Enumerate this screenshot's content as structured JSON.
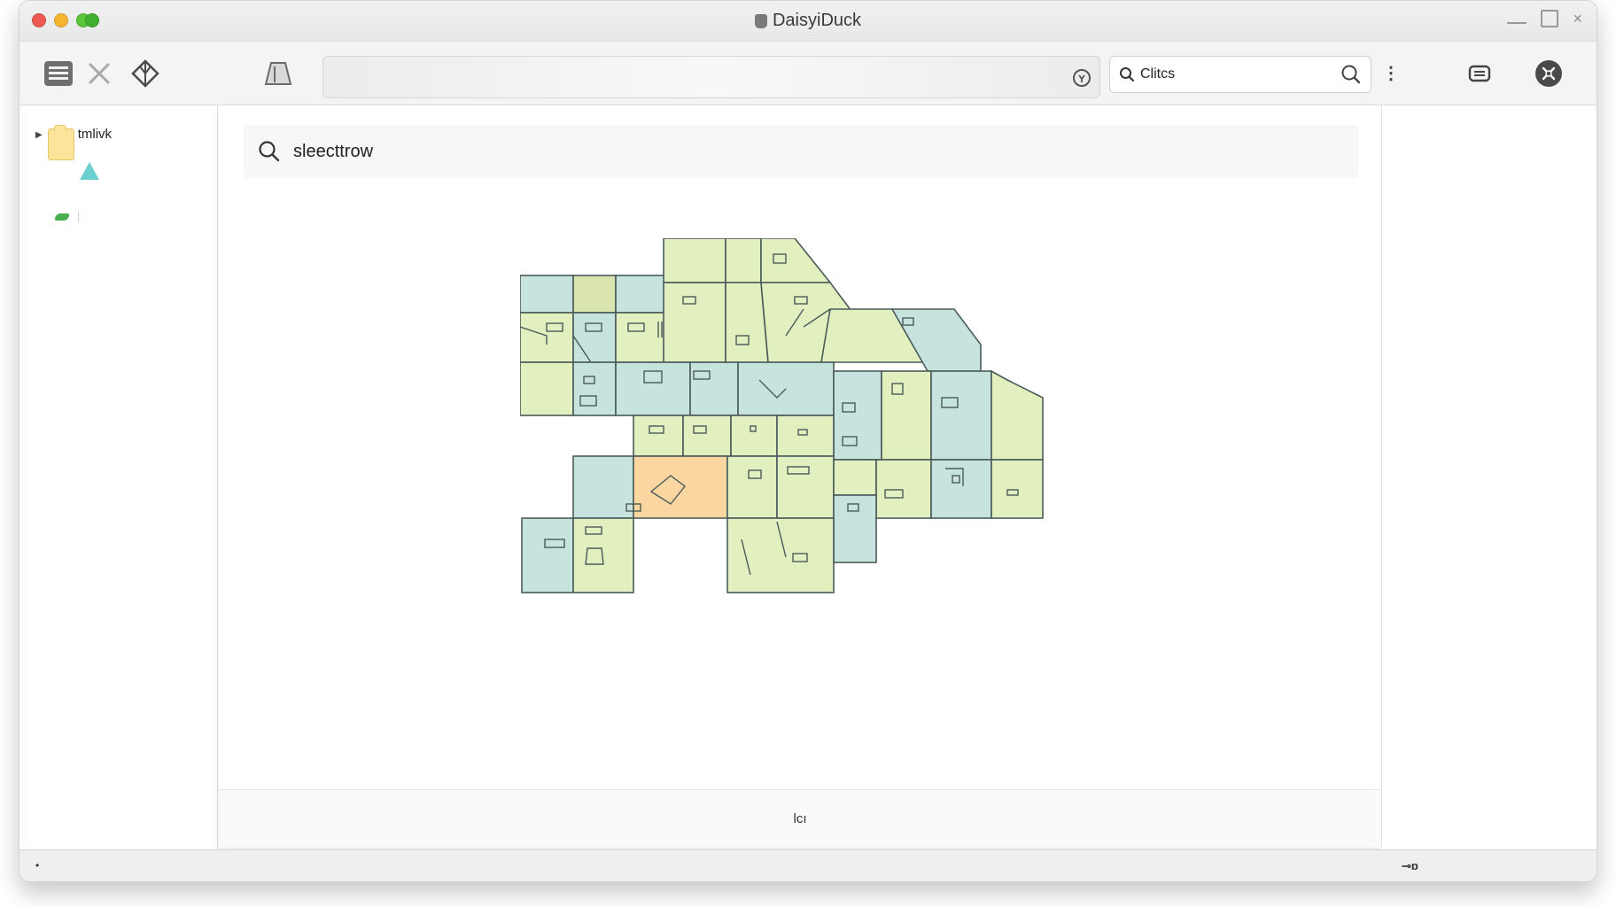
{
  "window": {
    "title": "DaisyiDuck"
  },
  "toolbar": {
    "search_placeholder": "Clitcs"
  },
  "sidebar": {
    "tree_item_label": "tmlivk"
  },
  "content": {
    "search_value": "sleecttrow",
    "footer_text": "lcı"
  },
  "statusbar": {
    "left_text": "•",
    "right_text": "⊸ɒ"
  },
  "colors": {
    "region_green": "#e2efbf",
    "region_blue": "#c6e3dd",
    "region_selected": "#fbd6a0",
    "region_olive": "#d9e4ae",
    "region_stroke": "#4a5b5a"
  },
  "map": {
    "highlighted_region": "orange-region"
  }
}
